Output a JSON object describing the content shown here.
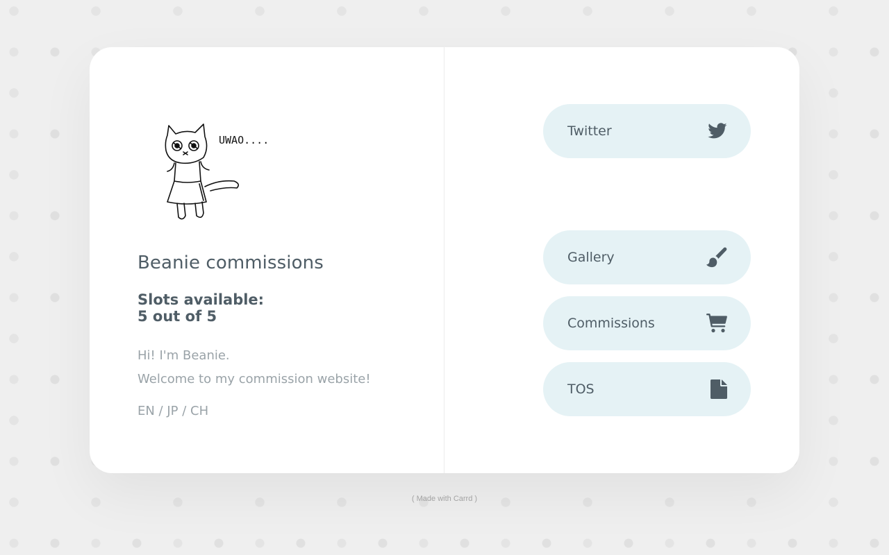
{
  "profile": {
    "drawing_text": "UWAO....",
    "title": "Beanie commissions",
    "slots_label": "Slots available:",
    "slots_value": "5 out of 5",
    "greeting": "Hi! I'm Beanie.",
    "welcome": "Welcome to my commission website!",
    "languages": "EN / JP / CH"
  },
  "links": {
    "twitter": {
      "label": "Twitter",
      "icon": "twitter-bird-icon"
    },
    "gallery": {
      "label": "Gallery",
      "icon": "paintbrush-icon"
    },
    "commissions": {
      "label": "Commissions",
      "icon": "shopping-cart-icon"
    },
    "tos": {
      "label": "TOS",
      "icon": "document-icon"
    }
  },
  "footer": {
    "open": "( ",
    "link_label": "Made with Carrd",
    "close": " )"
  },
  "colors": {
    "card_bg": "#ffffff",
    "button_bg": "#e5f2f5",
    "heading_text": "#4f5d66",
    "body_text": "#9aa3a8",
    "page_bg": "#efefef"
  }
}
